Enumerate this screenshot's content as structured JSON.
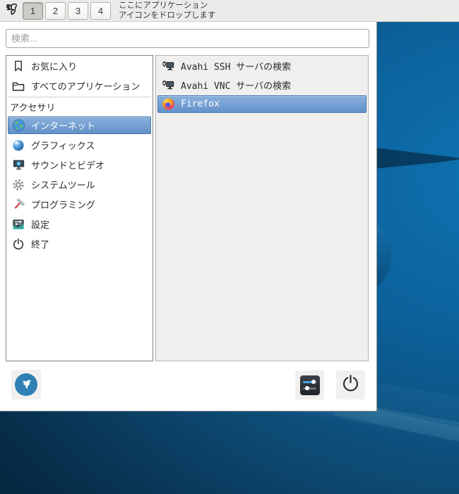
{
  "panel": {
    "workspaces": [
      {
        "label": "1",
        "active": true
      },
      {
        "label": "2",
        "active": false
      },
      {
        "label": "3",
        "active": false
      },
      {
        "label": "4",
        "active": false
      }
    ],
    "drop_hint_line1": "ここにアプリケーション",
    "drop_hint_line2": "アイコンをドロップします"
  },
  "menu": {
    "search": {
      "placeholder": "検索..."
    },
    "categories": [
      {
        "label": "お気に入り",
        "icon": "bookmark-icon"
      },
      {
        "label": "すべてのアプリケーション",
        "icon": "folder-icon"
      },
      {
        "label": "アクセサリ",
        "icon": "none",
        "header": true
      },
      {
        "label": "インターネット",
        "icon": "globe-icon",
        "selected": true
      },
      {
        "label": "グラフィックス",
        "icon": "orb-icon"
      },
      {
        "label": "サウンドとビデオ",
        "icon": "media-player-icon"
      },
      {
        "label": "システムツール",
        "icon": "gear-icon"
      },
      {
        "label": "プログラミング",
        "icon": "hatchet-icon"
      },
      {
        "label": "設定",
        "icon": "settings-icon"
      },
      {
        "label": "終了",
        "icon": "power-icon"
      }
    ],
    "apps": [
      {
        "label": "Avahi SSH サーバの検索",
        "icon": "network-monitor-icon",
        "selected": false
      },
      {
        "label": "Avahi VNC サーバの検索",
        "icon": "network-monitor-icon",
        "selected": false
      },
      {
        "label": "Firefox",
        "icon": "firefox-icon",
        "selected": true
      }
    ]
  },
  "colors": {
    "selection_top": "#8ab1dc",
    "selection_bottom": "#6391c9",
    "selection_border": "#4a7ab5",
    "panel_bg": "#ecebe9",
    "menu_bg": "#ffffff",
    "app_list_bg": "#f0efee",
    "logo_blue": "#2e80b5",
    "wallpaper_bright": "#0e74b4",
    "wallpaper_dark": "#041c2e"
  }
}
